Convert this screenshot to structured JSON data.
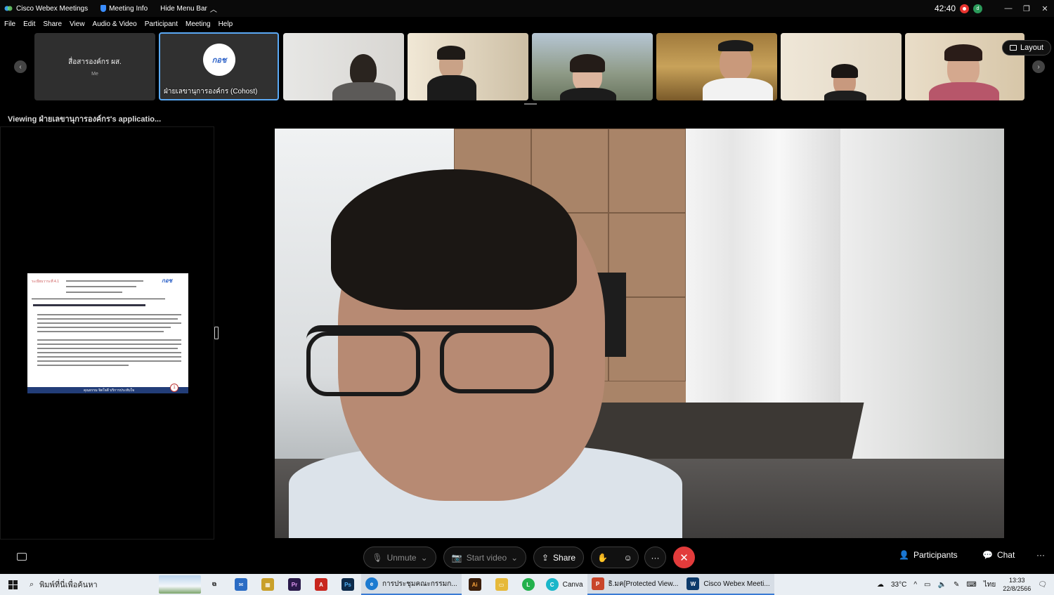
{
  "titlebar": {
    "app_name": "Cisco Webex Meetings",
    "meeting_info": "Meeting Info",
    "hide_menu": "Hide Menu Bar",
    "timer": "42:40",
    "enc_badge": "d"
  },
  "menu": [
    "File",
    "Edit",
    "Share",
    "View",
    "Audio & Video",
    "Participant",
    "Meeting",
    "Help"
  ],
  "strip": {
    "self_name": "สื่อสารองค์กร ผส.",
    "self_me": "Me",
    "cohost_logo": "กอช",
    "cohost_caption": "ฝ่ายเลขานุการองค์กร (Cohost)",
    "layout_label": "Layout"
  },
  "viewing_label": "Viewing ฝ่ายเลขานุการองค์กร's applicatio...",
  "slide": {
    "heading": "ระเบียบวาระที่ 4.1",
    "logo": "กอช",
    "footer": "คุณธรรม จิตใจดี บริการประทับใจ",
    "page": "1"
  },
  "controls": {
    "unmute": "Unmute",
    "start_video": "Start video",
    "share": "Share",
    "participants": "Participants",
    "chat": "Chat",
    "more": "···",
    "end": "✕"
  },
  "taskbar": {
    "search_placeholder": "พิมพ์ที่นี่เพื่อค้นหา",
    "app_meeting": "การประชุมคณะกรรมก...",
    "app_canva": "Canva",
    "app_ppt": "ธิ.มค[Protected View...",
    "app_webex": "Cisco Webex Meeti...",
    "weather": "33°C",
    "lang": "ไทย",
    "time": "13:33",
    "date": "22/8/2566"
  },
  "colors": {
    "accent_blue": "#5aa9f5",
    "end_red": "#e23b3b",
    "record_red": "#e8342f"
  }
}
